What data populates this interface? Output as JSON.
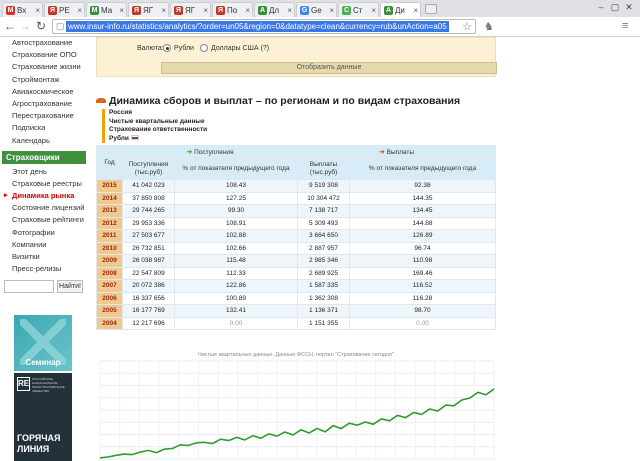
{
  "browser": {
    "tabs": [
      {
        "icon": "gmail-icon",
        "label": "Вх",
        "color": "#d93025",
        "glyph": "M"
      },
      {
        "icon": "ya-icon",
        "label": "РЕ",
        "color": "#c0392b",
        "glyph": "Я"
      },
      {
        "icon": "doc-icon",
        "label": "Ма",
        "color": "#3a8e3a",
        "glyph": "M"
      },
      {
        "icon": "ya-icon",
        "label": "ЯГ",
        "color": "#c0392b",
        "glyph": "Я"
      },
      {
        "icon": "ya-icon",
        "label": "ЯГ",
        "color": "#c0392b",
        "glyph": "Я"
      },
      {
        "icon": "ya-icon",
        "label": "По",
        "color": "#c0392b",
        "glyph": "Я"
      },
      {
        "icon": "doc-icon",
        "label": "Дл",
        "color": "#3a8e3a",
        "glyph": "A"
      },
      {
        "icon": "google-icon",
        "label": "Ge",
        "color": "#4285f4",
        "glyph": "G"
      },
      {
        "icon": "c-icon",
        "label": "Ст",
        "color": "#4caf50",
        "glyph": "C"
      },
      {
        "icon": "doc-icon",
        "label": "Ди",
        "color": "#3a8e3a",
        "glyph": "A",
        "active": true
      }
    ],
    "url": "www.insur-info.ru/statistics/analytics/?order=un05&region=0&datatype=clean&currency=rub&unAction=a05"
  },
  "sidebar": {
    "items_top": [
      "Автострахование",
      "Страхование ОПО",
      "Страхование жизни",
      "Строймонтаж",
      "Авиакосмическое",
      "Агрострахование",
      "Перестрахование",
      "Подписка",
      "Календарь"
    ],
    "section_title": "Страховщики",
    "items_bottom": [
      "Этот день",
      "Страховые реестры",
      "Динамика рынка",
      "Состояние лицензий",
      "Страховые рейтинги",
      "Фотографии",
      "Компании",
      "Визитки",
      "Пресс-релизы"
    ],
    "active_item": "Динамика рынка",
    "search_button": "Найти!",
    "banner1_label": "Семинар",
    "banner2_logo": "RE",
    "banner2_small": "РОССИЙСКОЕ НАЦИОНАЛЬНОЕ ПЕРЕСТРАХОВОЧНОЕ ОБЩЕСТВО",
    "banner2_big": "ГОРЯЧАЯ ЛИНИЯ"
  },
  "filters": {
    "currency_label": "Валюта:",
    "options": [
      "Рубли",
      "Доллары США (?)"
    ],
    "selected": "Рубли",
    "show_button": "Отобразить данные"
  },
  "report": {
    "title": "Динамика сборов и выплат – по регионам и по видам страхования",
    "params": [
      "Россия",
      "Чистые квартальные данные",
      "Страхование ответственности",
      "Рубли"
    ]
  },
  "table": {
    "group_headers": {
      "receipts": "Поступления",
      "payouts": "Выплаты"
    },
    "headers": {
      "year": "Год",
      "receipts": "Поступления (тыс.руб)",
      "receipts_pct": "% от показателя предыдущего года",
      "payouts": "Выплаты (тыс.руб)",
      "payouts_pct": "% от показателя предыдущего года"
    },
    "rows": [
      {
        "year": "2015",
        "receipts": "41 042 023",
        "receipts_pct": "108.43",
        "payouts": "9 519 308",
        "payouts_pct": "92.38"
      },
      {
        "year": "2014",
        "receipts": "37 850 808",
        "receipts_pct": "127.25",
        "payouts": "10 304 472",
        "payouts_pct": "144.35"
      },
      {
        "year": "2013",
        "receipts": "29 744 265",
        "receipts_pct": "99.30",
        "payouts": "7 138 717",
        "payouts_pct": "134.45"
      },
      {
        "year": "2012",
        "receipts": "29 953 336",
        "receipts_pct": "108.91",
        "payouts": "5 309 493",
        "payouts_pct": "144.88"
      },
      {
        "year": "2011",
        "receipts": "27 503 677",
        "receipts_pct": "102.88",
        "payouts": "3 664 650",
        "payouts_pct": "126.89"
      },
      {
        "year": "2010",
        "receipts": "26 732 851",
        "receipts_pct": "102.66",
        "payouts": "2 887 957",
        "payouts_pct": "96.74"
      },
      {
        "year": "2009",
        "receipts": "26 038 987",
        "receipts_pct": "115.48",
        "payouts": "2 985 346",
        "payouts_pct": "110.98"
      },
      {
        "year": "2008",
        "receipts": "22 547 809",
        "receipts_pct": "112.33",
        "payouts": "2 689 925",
        "payouts_pct": "169.46"
      },
      {
        "year": "2007",
        "receipts": "20 072 386",
        "receipts_pct": "122.86",
        "payouts": "1 587 335",
        "payouts_pct": "116.52"
      },
      {
        "year": "2006",
        "receipts": "16 337 656",
        "receipts_pct": "100.89",
        "payouts": "1 362 308",
        "payouts_pct": "116.28"
      },
      {
        "year": "2005",
        "receipts": "16 177 769",
        "receipts_pct": "132.41",
        "payouts": "1 136 371",
        "payouts_pct": "98.70"
      },
      {
        "year": "2004",
        "receipts": "12 217 696",
        "receipts_pct": "0.00",
        "payouts": "1 151 355",
        "payouts_pct": "0.00"
      }
    ]
  },
  "chart_data": {
    "type": "line",
    "title": "Чистые квартальные данные. Данные ФССН, портал \"Страхование сегодня\"",
    "series": [
      {
        "color": "#2e9c2e",
        "values": [
          0.5,
          0.8,
          1.5,
          2.0,
          1.8,
          2.8,
          3.5,
          2.6,
          4.0,
          4.3,
          5.8,
          5.5,
          6.6,
          6.8,
          6.3,
          8.1,
          7.5,
          8.8,
          7.8,
          9.5,
          8.5,
          10.3,
          9.3,
          11.0,
          9.8,
          11.9,
          10.6,
          12.5,
          11.1,
          13.6,
          12.4,
          14.6,
          13.8,
          15.1,
          14.2,
          16.4,
          15.6,
          17.8,
          16.9,
          19.0,
          18.2,
          20.4,
          19.6,
          22.0,
          21.7,
          24.1,
          24.9,
          27.2,
          26.2,
          28.6
        ]
      }
    ],
    "ylim": [
      0,
      40
    ],
    "grid": true
  }
}
